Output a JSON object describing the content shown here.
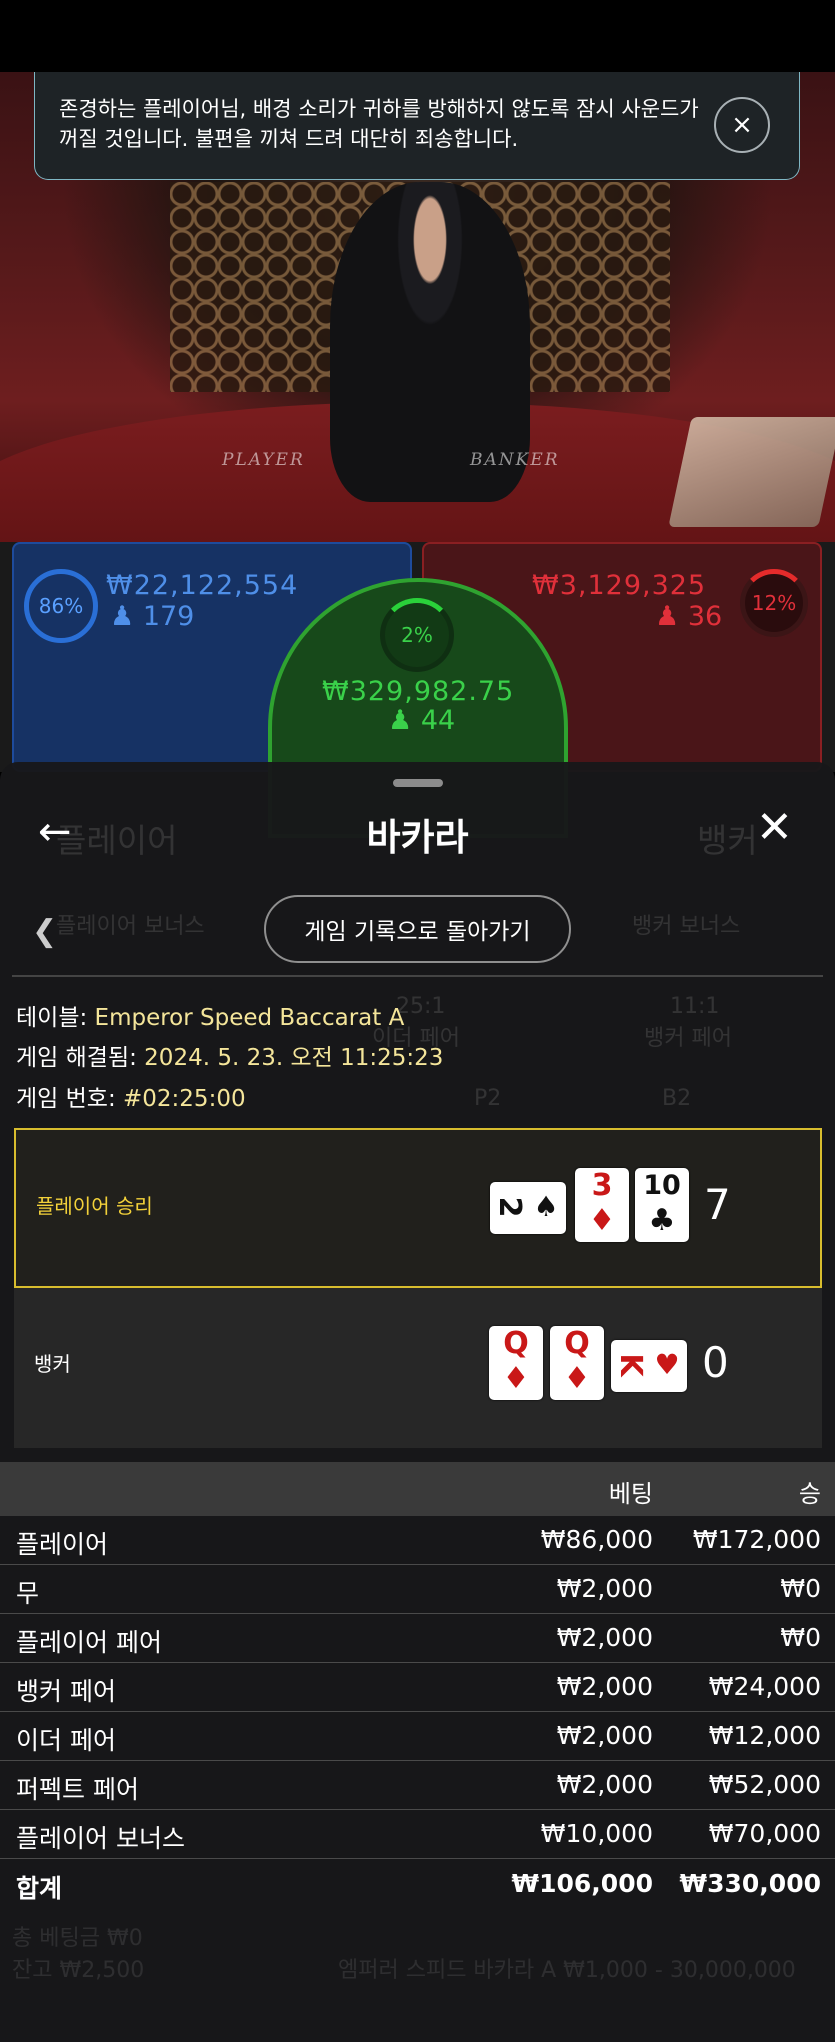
{
  "toast": {
    "message": "존경하는 플레이어님, 배경 소리가 귀하를 방해하지 않도록 잠시 사운드가 꺼질 것입니다. 불편을 끼쳐 드려 대단히 죄송합니다.",
    "close_icon": "×"
  },
  "video": {
    "felt_player": "PLAYER",
    "felt_banker": "BANKER"
  },
  "bets": {
    "player": {
      "percent": "86%",
      "amount": "₩22,122,554",
      "count": "179"
    },
    "tie": {
      "percent": "2%",
      "amount": "₩329,982.75",
      "count": "44"
    },
    "banker": {
      "percent": "12%",
      "amount": "₩3,129,325",
      "count": "36"
    },
    "colors": {
      "player": "#2a6fd6",
      "banker": "#e0303a",
      "tie": "#3ad14a"
    }
  },
  "sheet": {
    "title": "바카라",
    "back_icon": "←",
    "close_icon": "✕",
    "history_button": "게임 기록으로 돌아가기",
    "ghost": {
      "player": "플레이어",
      "banker": "뱅커",
      "player_bonus": "플레이어 보너스",
      "banker_bonus": "뱅커 보너스",
      "odds1": "25:1",
      "odds2": "11:1",
      "either_pair": "이더 페어",
      "banker_pair": "뱅커 페어",
      "p2": "P2",
      "b2": "B2",
      "balance": "잔고 ₩2,500",
      "total_bet": "총 베팅금 ₩0",
      "table_limit": "엠퍼러 스피드 바카라 A ₩1,000 - 30,000,000"
    },
    "info": {
      "table_label": "테이블: ",
      "table_value": "Emperor Speed Baccarat A",
      "resolved_label": "게임 해결됨: ",
      "resolved_value": "2024. 5. 23. 오전 11:25:23",
      "game_no_label": "게임 번호: ",
      "game_no_value": "#02:25:00"
    },
    "result": {
      "player_label": "플레이어 승리",
      "player_score": "7",
      "player_cards": [
        {
          "rank": "2",
          "suit": "♠",
          "color": "black",
          "sideways": true
        },
        {
          "rank": "3",
          "suit": "♦",
          "color": "red",
          "sideways": false
        },
        {
          "rank": "10",
          "suit": "♣",
          "color": "black",
          "sideways": false
        }
      ],
      "banker_label": "뱅커",
      "banker_score": "0",
      "banker_cards": [
        {
          "rank": "Q",
          "suit": "♦",
          "color": "red",
          "sideways": false
        },
        {
          "rank": "Q",
          "suit": "♦",
          "color": "red",
          "sideways": false
        },
        {
          "rank": "K",
          "suit": "♥",
          "color": "red",
          "sideways": true
        }
      ],
      "win_color": "#d8bd2e"
    },
    "table": {
      "headers": {
        "bet": "베팅",
        "win": "승"
      },
      "rows": [
        {
          "name": "플레이어",
          "bet": "₩86,000",
          "win": "₩172,000"
        },
        {
          "name": "무",
          "bet": "₩2,000",
          "win": "₩0"
        },
        {
          "name": "플레이어 페어",
          "bet": "₩2,000",
          "win": "₩0"
        },
        {
          "name": "뱅커 페어",
          "bet": "₩2,000",
          "win": "₩24,000"
        },
        {
          "name": "이더 페어",
          "bet": "₩2,000",
          "win": "₩12,000"
        },
        {
          "name": "퍼펙트 페어",
          "bet": "₩2,000",
          "win": "₩52,000"
        },
        {
          "name": "플레이어 보너스",
          "bet": "₩10,000",
          "win": "₩70,000"
        }
      ],
      "total": {
        "name": "합계",
        "bet": "₩106,000",
        "win": "₩330,000"
      }
    }
  }
}
